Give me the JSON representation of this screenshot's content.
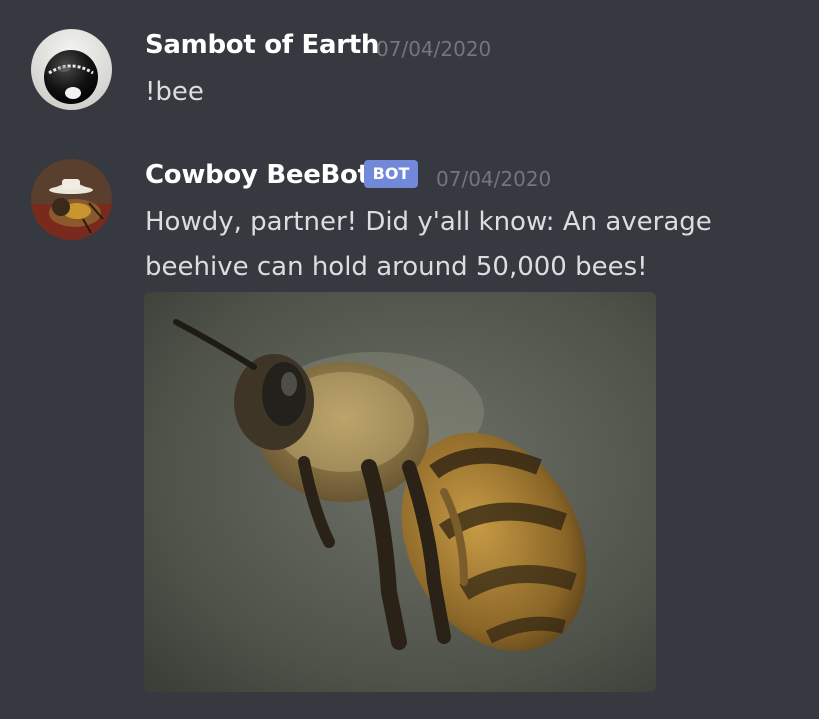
{
  "messages": [
    {
      "username": "Sambot of Earth",
      "timestamp": "07/04/2020",
      "lines": [
        "!bee"
      ],
      "avatar_icon": "magic-8-ball-icon"
    },
    {
      "username": "Cowboy BeeBot",
      "badge": "BOT",
      "timestamp": "07/04/2020",
      "lines": [
        "Howdy, partner! Did y'all know: An average",
        "beehive can hold around 50,000 bees!"
      ],
      "avatar_icon": "cowboy-bee-icon",
      "attachment": {
        "type": "image",
        "subject": "flying honeybee"
      }
    }
  ],
  "colors": {
    "background": "#36393f",
    "username": "#ffffff",
    "timestamp": "#72767d",
    "message_text": "#dcddde",
    "bot_badge": "#7289da"
  }
}
